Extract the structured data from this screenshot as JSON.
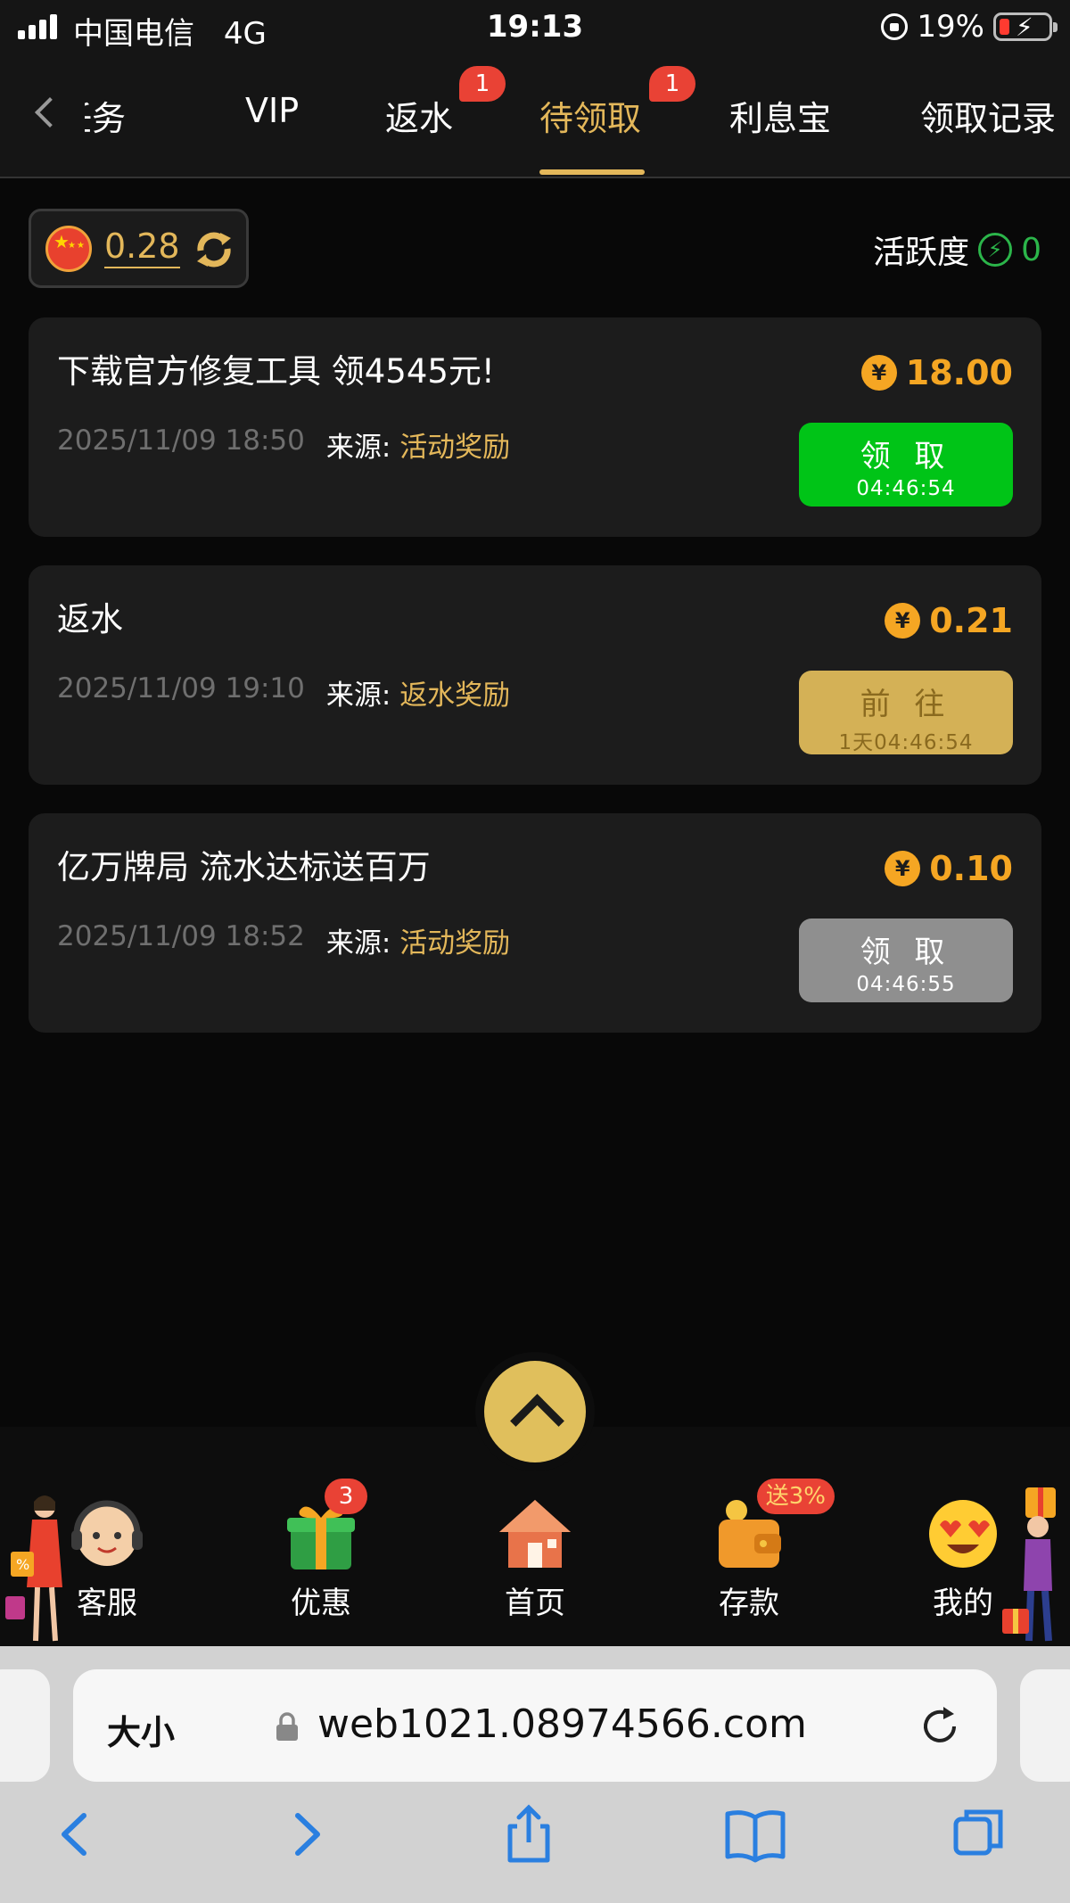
{
  "status_bar": {
    "carrier": "中国电信",
    "network": "4G",
    "time": "19:13",
    "battery": "19%"
  },
  "tabs": [
    {
      "label": "任务"
    },
    {
      "label": "VIP"
    },
    {
      "label": "返水",
      "badge": "1"
    },
    {
      "label": "待领取",
      "badge": "1",
      "active": true
    },
    {
      "label": "利息宝"
    },
    {
      "label": "领取记录"
    }
  ],
  "balance": {
    "amount": "0.28",
    "activity_label": "活跃度",
    "activity_value": "0"
  },
  "rewards": [
    {
      "title": "下载官方修复工具 领4545元!",
      "date": "2025/11/09 18:50",
      "source_label": "来源:",
      "source": "活动奖励",
      "coin": "¥",
      "amount": "18.00",
      "button_label": "领 取",
      "button_timer": "04:46:54",
      "button_state": "green"
    },
    {
      "title": "返水",
      "date": "2025/11/09 19:10",
      "source_label": "来源:",
      "source": "返水奖励",
      "coin": "¥",
      "amount": "0.21",
      "button_label": "前 往",
      "button_timer": "1天04:46:54",
      "button_state": "gold"
    },
    {
      "title": "亿万牌局 流水达标送百万",
      "date": "2025/11/09 18:52",
      "source_label": "来源:",
      "source": "活动奖励",
      "coin": "¥",
      "amount": "0.10",
      "button_label": "领 取",
      "button_timer": "04:46:55",
      "button_state": "gray"
    }
  ],
  "bottom_nav": [
    {
      "label": "客服",
      "icon": "customer-service-icon"
    },
    {
      "label": "优惠",
      "icon": "gift-icon",
      "badge": "3"
    },
    {
      "label": "首页",
      "icon": "home-icon"
    },
    {
      "label": "存款",
      "icon": "wallet-icon",
      "badge": "送3%"
    },
    {
      "label": "我的",
      "icon": "heart-eyes-icon"
    }
  ],
  "browser": {
    "text_size": "大小",
    "url": "web1021.08974566.com"
  },
  "colors": {
    "accent_gold": "#e3b75a",
    "amount_orange": "#f5a623",
    "green": "#00c417",
    "badge_red": "#e94235"
  }
}
